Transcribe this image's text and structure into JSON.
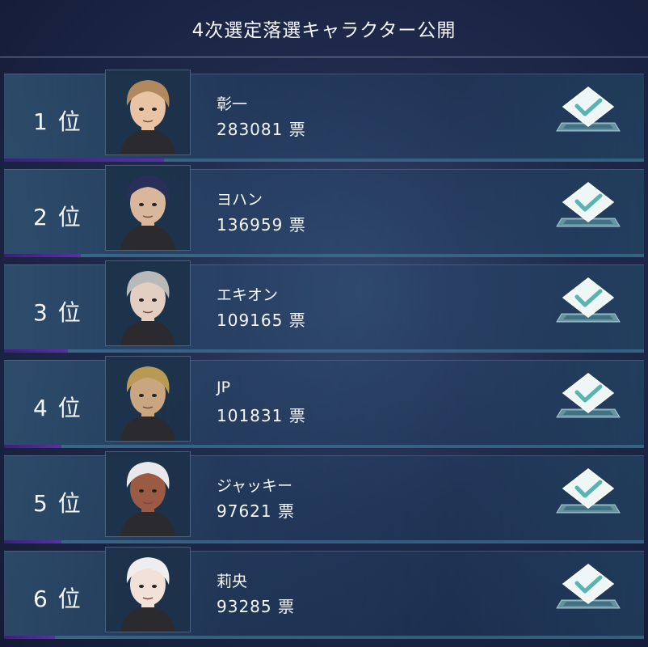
{
  "header": {
    "title": "4次選定落選キャラクター公開"
  },
  "rank_suffix": "位",
  "vote_suffix": "票",
  "colors": {
    "progress": "#5a2fa8",
    "accent_line": "#4682a0"
  },
  "rows": [
    {
      "rank": "1 位",
      "name": "彰一",
      "votes": "283081 票",
      "progress": 0.25,
      "hair": "#b08a5e",
      "skin": "#e8c4a4"
    },
    {
      "rank": "2 位",
      "name": "ヨハン",
      "votes": "136959 票",
      "progress": 0.12,
      "hair": "#2a2f5a",
      "skin": "#d9b79c"
    },
    {
      "rank": "3 位",
      "name": "エキオン",
      "votes": "109165 票",
      "progress": 0.1,
      "hair": "#b9b9b9",
      "skin": "#e2cfc2"
    },
    {
      "rank": "4 位",
      "name": "JP",
      "votes": "101831 票",
      "progress": 0.09,
      "hair": "#b89a55",
      "skin": "#caa680"
    },
    {
      "rank": "5 位",
      "name": "ジャッキー",
      "votes": "97621 票",
      "progress": 0.09,
      "hair": "#e9e9ec",
      "skin": "#9a5a44"
    },
    {
      "rank": "6 位",
      "name": "莉央",
      "votes": "93285 票",
      "progress": 0.08,
      "hair": "#eeeeef",
      "skin": "#f1e1d6"
    }
  ]
}
